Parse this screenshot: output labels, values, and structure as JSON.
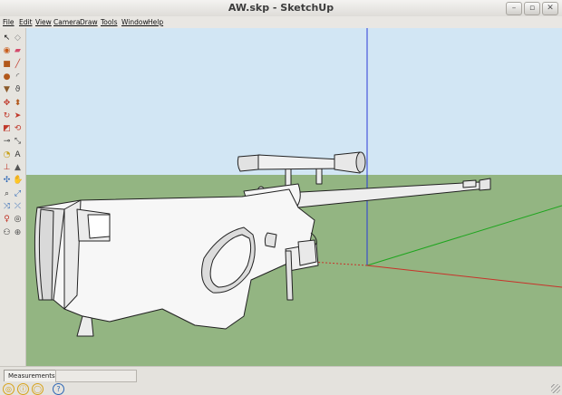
{
  "window": {
    "title": "AW.skp - SketchUp",
    "controls": [
      "–",
      "▫",
      "✕"
    ]
  },
  "menu": [
    "File",
    "Edit",
    "View",
    "Camera",
    "Draw",
    "Tools",
    "Window",
    "Help"
  ],
  "toolbar": {
    "tools": [
      {
        "name": "select-icon",
        "glyph": "↖",
        "color": "#111"
      },
      {
        "name": "make-component-icon",
        "glyph": "◇",
        "color": "#888"
      },
      {
        "name": "paint-bucket-icon",
        "glyph": "◉",
        "color": "#c85b1a"
      },
      {
        "name": "eraser-icon",
        "glyph": "▰",
        "color": "#d34a6a"
      },
      {
        "name": "rectangle-icon",
        "glyph": "■",
        "color": "#b2581b"
      },
      {
        "name": "line-icon",
        "glyph": "╱",
        "color": "#c0392b"
      },
      {
        "name": "circle-icon",
        "glyph": "●",
        "color": "#b2581b"
      },
      {
        "name": "arc-icon",
        "glyph": "◜",
        "color": "#444"
      },
      {
        "name": "polygon-icon",
        "glyph": "▼",
        "color": "#8b5a2b"
      },
      {
        "name": "freehand-icon",
        "glyph": "ϑ",
        "color": "#444"
      },
      {
        "name": "move-icon",
        "glyph": "✥",
        "color": "#c0392b"
      },
      {
        "name": "push-pull-icon",
        "glyph": "⬍",
        "color": "#b2581b"
      },
      {
        "name": "rotate-icon",
        "glyph": "↻",
        "color": "#c0392b"
      },
      {
        "name": "follow-me-icon",
        "glyph": "➤",
        "color": "#c0392b"
      },
      {
        "name": "scale-icon",
        "glyph": "◩",
        "color": "#c0392b"
      },
      {
        "name": "offset-icon",
        "glyph": "⟲",
        "color": "#c0392b"
      },
      {
        "name": "tape-measure-icon",
        "glyph": "⊸",
        "color": "#333"
      },
      {
        "name": "dimension-icon",
        "glyph": "⤡",
        "color": "#444"
      },
      {
        "name": "protractor-icon",
        "glyph": "◔",
        "color": "#c8a11a"
      },
      {
        "name": "text-icon",
        "glyph": "A",
        "color": "#333"
      },
      {
        "name": "axes-icon",
        "glyph": "⊥",
        "color": "#c0392b"
      },
      {
        "name": "3d-text-icon",
        "glyph": "▲",
        "color": "#555"
      },
      {
        "name": "orbit-icon",
        "glyph": "✣",
        "color": "#2d66b5"
      },
      {
        "name": "pan-icon",
        "glyph": "✋",
        "color": "#444"
      },
      {
        "name": "zoom-icon",
        "glyph": "⌕",
        "color": "#333"
      },
      {
        "name": "zoom-window-icon",
        "glyph": "⤢",
        "color": "#2d66b5"
      },
      {
        "name": "zoom-extents-icon",
        "glyph": "⤨",
        "color": "#2d66b5"
      },
      {
        "name": "previous-view-icon",
        "glyph": "⤫",
        "color": "#2d66b5"
      },
      {
        "name": "position-camera-icon",
        "glyph": "♀",
        "color": "#c0392b"
      },
      {
        "name": "look-around-icon",
        "glyph": "◎",
        "color": "#333"
      },
      {
        "name": "walk-icon",
        "glyph": "⚇",
        "color": "#333"
      },
      {
        "name": "section-plane-icon",
        "glyph": "⊕",
        "color": "#555"
      }
    ]
  },
  "scene": {
    "sky": "#d2e6f4",
    "ground": "#93b582",
    "axis_red": "#c8322a",
    "axis_green": "#1ea51e",
    "axis_blue": "#2a3ad6"
  },
  "status": {
    "measurements_label": "Measurements",
    "icons": [
      {
        "name": "geo-location-icon",
        "glyph": "◎",
        "color": "#d8a31a"
      },
      {
        "name": "credits-icon",
        "glyph": "ⓘ",
        "color": "#d8a31a"
      },
      {
        "name": "user-icon",
        "glyph": "◯",
        "color": "#d8a31a"
      },
      {
        "name": "help-icon",
        "glyph": "?",
        "color": "#2d66b5"
      }
    ]
  }
}
